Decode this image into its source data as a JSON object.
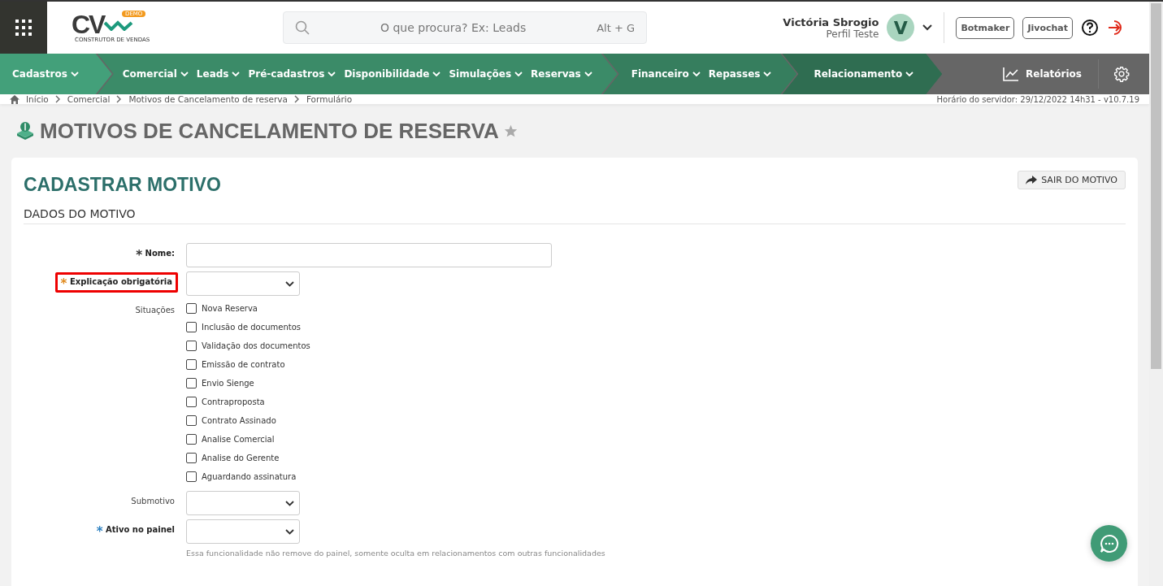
{
  "header": {
    "logo": {
      "mark": "CV",
      "badge": "DEMO",
      "tagline": "CONSTRUTOR DE VENDAS"
    },
    "search": {
      "placeholder": "O que procura? Ex: Leads",
      "shortcut": "Alt + G"
    },
    "user": {
      "name": "Victória Sbrogio",
      "profile": "Perfil Teste",
      "initial": "V"
    },
    "buttons": [
      "Botmaker",
      "Jivochat"
    ]
  },
  "nav": {
    "groups": [
      {
        "items": [
          "Cadastros"
        ]
      },
      {
        "items": [
          "Comercial",
          "Leads",
          "Pré-cadastros",
          "Disponibilidade",
          "Simulações",
          "Reservas"
        ]
      },
      {
        "items": [
          "Financeiro",
          "Repasses"
        ]
      },
      {
        "items": [
          "Relacionamento"
        ]
      }
    ],
    "reports": "Relatórios"
  },
  "breadcrumb": [
    "Início",
    "Comercial",
    "Motivos de Cancelamento de reserva",
    "Formulário"
  ],
  "server_time": "Horário do servidor: 29/12/2022 14h31 - v10.7.19",
  "page_title": "MOTIVOS DE CANCELAMENTO DE RESERVA",
  "card": {
    "title": "CADASTRAR MOTIVO",
    "exit_button": "SAIR DO MOTIVO",
    "section": "DADOS DO MOTIVO",
    "fields": [
      {
        "kind": "text",
        "label": "Nome:",
        "required_mark": "*",
        "color": "#333333",
        "highlighted": false
      },
      {
        "kind": "select",
        "label": "Explicação obrigatória",
        "required_mark": "*",
        "color": "#e08a1e",
        "highlighted": true
      },
      {
        "kind": "checks",
        "label": "Situações",
        "highlighted": false,
        "options": [
          {
            "label": "Nova Reserva",
            "checked": false
          },
          {
            "label": "Inclusão de documentos",
            "checked": false
          },
          {
            "label": "Validação dos documentos",
            "checked": false
          },
          {
            "label": "Emissão de contrato",
            "checked": false
          },
          {
            "label": "Envio Sienge",
            "checked": false
          },
          {
            "label": "Contraproposta",
            "checked": false
          },
          {
            "label": "Contrato Assinado",
            "checked": false
          },
          {
            "label": "Analise Comercial",
            "checked": false
          },
          {
            "label": "Analise do Gerente",
            "checked": false
          },
          {
            "label": "Aguardando assinatura",
            "checked": false
          }
        ]
      },
      {
        "kind": "select",
        "label": "Submotivo",
        "highlighted": false
      },
      {
        "kind": "select",
        "label": "Ativo no painel",
        "required_mark": "*",
        "color": "#2a7fc0",
        "highlighted": false,
        "help": "Essa funcionalidade não remove do painel, somente oculta em relacionamentos com outras funcionalidades"
      }
    ]
  }
}
